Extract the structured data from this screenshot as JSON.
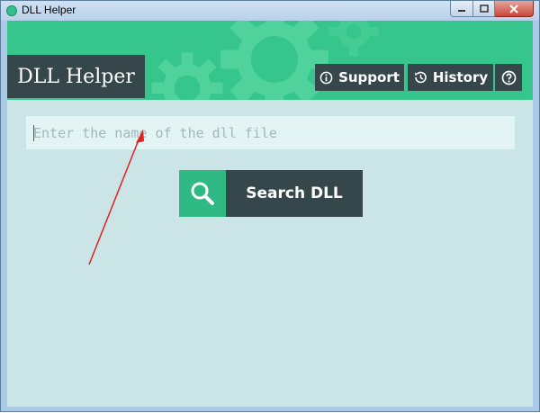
{
  "window": {
    "title": "DLL Helper"
  },
  "header": {
    "brand": "DLL Helper",
    "support_label": "Support",
    "history_label": "History"
  },
  "search": {
    "placeholder": "Enter the name of the dll file",
    "value": "",
    "button_label": "Search DLL"
  },
  "icons": [
    "info-icon",
    "history-icon",
    "help-icon",
    "search-icon",
    "gear-icon"
  ],
  "colors": {
    "header_green": "#36c68d",
    "dark_slate": "#35474b",
    "body_bg": "#cbe5e6",
    "input_bg": "#e2f4f4",
    "arrow_red": "#e02020"
  }
}
